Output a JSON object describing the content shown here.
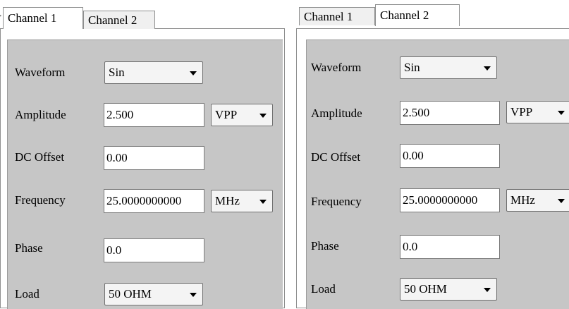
{
  "tabs": [
    "Channel 1",
    "Channel 2"
  ],
  "fields": {
    "waveform_label": "Waveform",
    "amplitude_label": "Amplitude",
    "dc_offset_label": "DC Offset",
    "frequency_label": "Frequency",
    "phase_label": "Phase",
    "load_label": "Load"
  },
  "left": {
    "waveform": "Sin",
    "amplitude": "2.500",
    "amplitude_unit": "VPP",
    "dc_offset": "0.00",
    "frequency": "25.0000000000",
    "frequency_unit": "MHz",
    "phase": "0.0",
    "load": "50 OHM"
  },
  "right": {
    "waveform": "Sin",
    "amplitude": "2.500",
    "amplitude_unit": "VPP",
    "dc_offset": "0.00",
    "frequency": "25.0000000000",
    "frequency_unit": "MHz",
    "phase": "0.0",
    "load": "50 OHM"
  }
}
